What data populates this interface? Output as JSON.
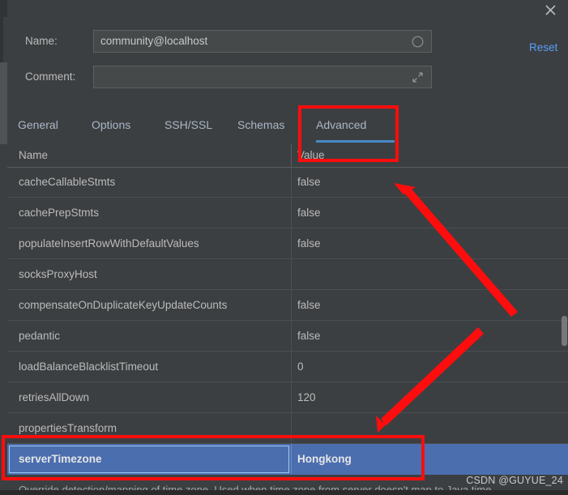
{
  "window": {
    "close_icon": "close-x-icon"
  },
  "form": {
    "name_label": "Name:",
    "name_value": "community@localhost",
    "name_adorn_icon": "circle-icon",
    "comment_label": "Comment:",
    "comment_value": "",
    "comment_placeholder": "",
    "comment_adorn_icon": "expand-diagonal-icon",
    "reset_label": "Reset"
  },
  "tabs": {
    "items": [
      {
        "label": "General",
        "selected": false
      },
      {
        "label": "Options",
        "selected": false
      },
      {
        "label": "SSH/SSL",
        "selected": false
      },
      {
        "label": "Schemas",
        "selected": false
      },
      {
        "label": "Advanced",
        "selected": true
      }
    ]
  },
  "table": {
    "headers": {
      "name": "Name",
      "value": "Value"
    },
    "rows": [
      {
        "name": "cacheCallableStmts",
        "value": "false",
        "selected": false
      },
      {
        "name": "cachePrepStmts",
        "value": "false",
        "selected": false
      },
      {
        "name": "populateInsertRowWithDefaultValues",
        "value": "false",
        "selected": false
      },
      {
        "name": "socksProxyHost",
        "value": "",
        "selected": false
      },
      {
        "name": "compensateOnDuplicateKeyUpdateCounts",
        "value": "false",
        "selected": false
      },
      {
        "name": "pedantic",
        "value": "false",
        "selected": false
      },
      {
        "name": "loadBalanceBlacklistTimeout",
        "value": "0",
        "selected": false
      },
      {
        "name": "retriesAllDown",
        "value": "120",
        "selected": false
      },
      {
        "name": "propertiesTransform",
        "value": "",
        "selected": false
      },
      {
        "name": "serverTimezone",
        "value": "Hongkong",
        "selected": true
      }
    ]
  },
  "description": "Override detection/mapping of time zone. Used when time zone from server doesn't map to Java time",
  "watermark": "CSDN @GUYUE_24",
  "colors": {
    "background": "#3c3f41",
    "selection": "#4b6eaf",
    "accent": "#4a88c7",
    "link": "#589df6",
    "annotation": "#fd0d0d"
  }
}
